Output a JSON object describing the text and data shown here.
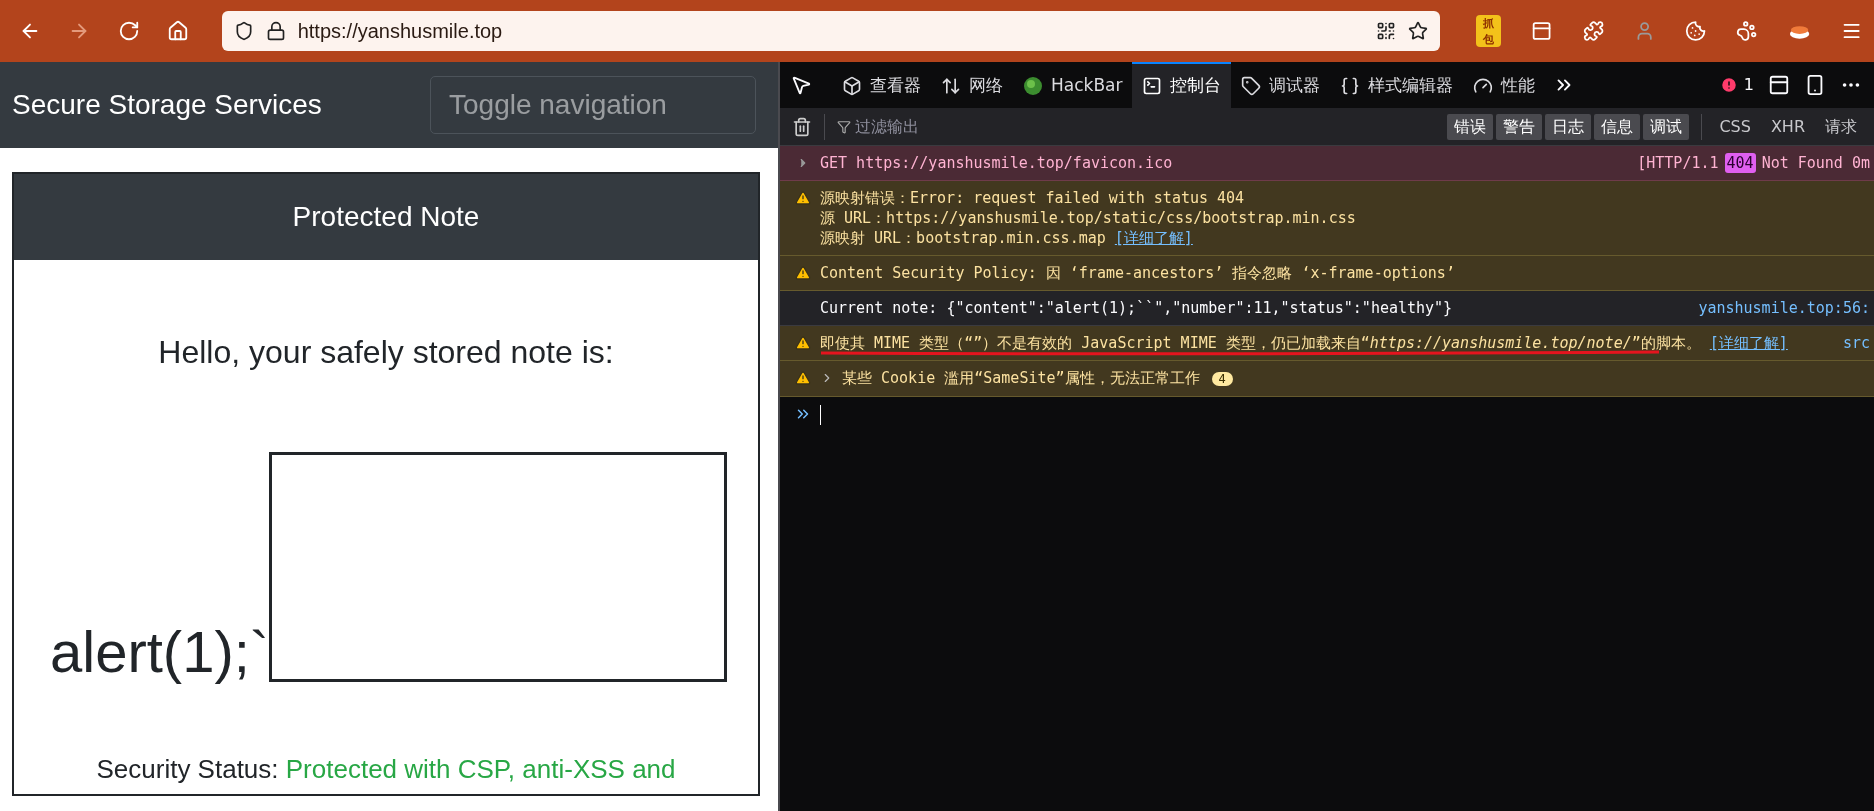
{
  "browser": {
    "nav_buttons": [
      {
        "kind": "back",
        "disabled": false
      },
      {
        "kind": "forward",
        "disabled": true
      },
      {
        "kind": "reload",
        "disabled": false
      },
      {
        "kind": "home",
        "disabled": false
      }
    ],
    "url": "https://yanshusmile.top",
    "extensions": [
      {
        "kind": "capture",
        "label": "抓包"
      },
      {
        "kind": "panel"
      },
      {
        "kind": "puzzle"
      },
      {
        "kind": "figure"
      },
      {
        "kind": "cookie"
      },
      {
        "kind": "paw"
      },
      {
        "kind": "sushi"
      },
      {
        "kind": "menu"
      }
    ]
  },
  "page": {
    "brand": "Secure Storage Services",
    "toggle_button": "Toggle navigation",
    "card": {
      "title": "Protected Note",
      "greeting": "Hello, your safely stored note is:",
      "note": "alert(1);`",
      "status_label": "Security Status:",
      "status_value": "Protected with CSP, anti-XSS and"
    }
  },
  "devtools": {
    "tabs": [
      {
        "kind": "inspector",
        "label": "查看器",
        "selected": false
      },
      {
        "kind": "network",
        "label": "网络",
        "selected": false
      },
      {
        "kind": "hackbar",
        "label": "HackBar",
        "selected": false
      },
      {
        "kind": "console",
        "label": "控制台",
        "selected": true
      },
      {
        "kind": "debugger",
        "label": "调试器",
        "selected": false
      },
      {
        "kind": "style",
        "label": "样式编辑器",
        "selected": false
      },
      {
        "kind": "performance",
        "label": "性能",
        "selected": false
      }
    ],
    "error_count": "1",
    "filter": {
      "placeholder": "过滤输出"
    },
    "levels": [
      {
        "label": "错误",
        "selected": true
      },
      {
        "label": "警告",
        "selected": true
      },
      {
        "label": "日志",
        "selected": true
      },
      {
        "label": "信息",
        "selected": true
      },
      {
        "label": "调试",
        "selected": true
      }
    ],
    "request_filters": [
      {
        "label": "CSS",
        "selected": false
      },
      {
        "label": "XHR",
        "selected": false
      },
      {
        "label": "请求",
        "selected": false
      }
    ],
    "messages": [
      {
        "kind": "network_error",
        "lines": [
          "GET https://yanshusmile.top/favicon.ico"
        ],
        "status_prefix": "[HTTP/1.1",
        "status_code": "404",
        "status_text": "Not Found 0m"
      },
      {
        "kind": "warning",
        "lines": [
          "源映射错误：Error: request failed with status 404",
          "源 URL：https://yanshusmile.top/static/css/bootstrap.min.css",
          "源映射 URL：bootstrap.min.css.map"
        ],
        "link": "[详细了解]"
      },
      {
        "kind": "warning",
        "lines": [
          "Content Security Policy: 因 ‘frame-ancestors’ 指令忽略 ‘x-frame-options’"
        ]
      },
      {
        "kind": "log",
        "lines": [
          "Current note: {\"content\":\"alert(1);``\",\"number\":11,\"status\":\"healthy\"}"
        ],
        "source": "yanshusmile.top:56:"
      },
      {
        "kind": "warning",
        "lines": [
          "即使其 MIME 类型（“”）不是有效的 JavaScript MIME 类型，仍已加载来自“*https://yanshusmile.top/note/*”的脚本。"
        ],
        "link": "[详细了解]",
        "source": "src",
        "marked": true
      },
      {
        "kind": "warning",
        "lines": [
          "某些 Cookie 滥用“SameSite”属性，无法正常工作"
        ],
        "expanded": false,
        "count": "4"
      }
    ]
  }
}
